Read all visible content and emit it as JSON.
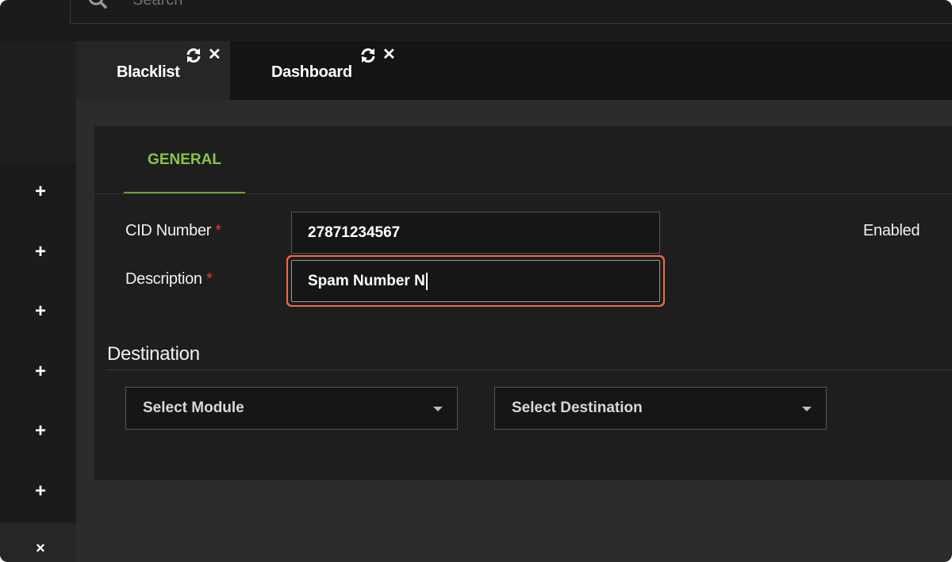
{
  "search": {
    "placeholder": "Search"
  },
  "tabs": [
    {
      "label": "Blacklist",
      "active": true
    },
    {
      "label": "Dashboard",
      "active": false
    }
  ],
  "sidebar": {
    "add_buttons": [
      "+",
      "+",
      "+",
      "+",
      "+",
      "+"
    ],
    "close": "×"
  },
  "form": {
    "tab_label": "GENERAL",
    "cid_label": "CID Number",
    "cid_value": "27871234567",
    "description_label": "Description",
    "description_value": "Spam Number N",
    "required_marker": "*",
    "enabled_label": "Enabled",
    "destination_title": "Destination",
    "select_module": "Select Module",
    "select_destination": "Select Destination"
  },
  "colors": {
    "accent_green": "#8bc34a",
    "focus_ring": "#ef6a45",
    "required_red": "#e53935"
  }
}
